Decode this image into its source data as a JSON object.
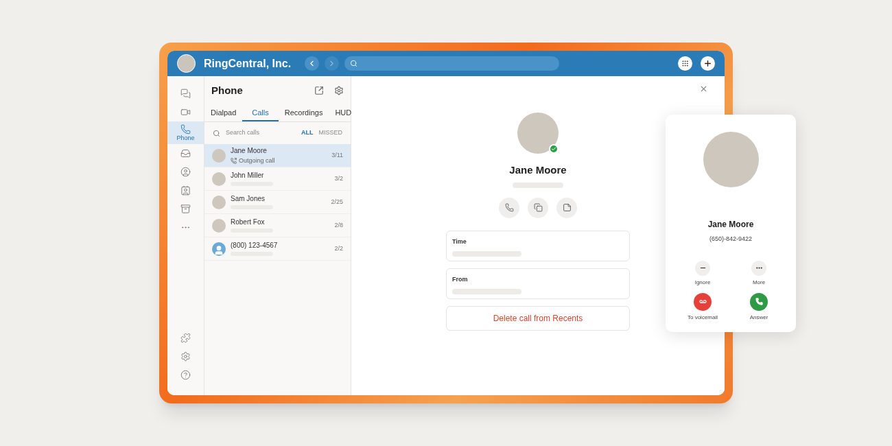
{
  "header": {
    "title": "RingCentral, Inc."
  },
  "rail": {
    "items": [
      {
        "kind": "messages",
        "selected": false
      },
      {
        "kind": "video",
        "selected": false
      },
      {
        "kind": "phone",
        "label": "Phone",
        "selected": true
      },
      {
        "kind": "inbox",
        "selected": false
      },
      {
        "kind": "contacts",
        "selected": false
      },
      {
        "kind": "directory",
        "selected": false
      },
      {
        "kind": "tray",
        "selected": false
      },
      {
        "kind": "more",
        "selected": false
      }
    ],
    "bottom": [
      {
        "kind": "apps"
      },
      {
        "kind": "settings"
      },
      {
        "kind": "help"
      }
    ]
  },
  "panel": {
    "title": "Phone",
    "tabs": [
      {
        "label": "Dialpad",
        "selected": false
      },
      {
        "label": "Calls",
        "selected": true
      },
      {
        "label": "Recordings",
        "selected": false
      },
      {
        "label": "HUD",
        "selected": false
      }
    ],
    "search": {
      "placeholder": "Search calls"
    },
    "filters": [
      {
        "label": "ALL",
        "selected": true
      },
      {
        "label": "MISSED",
        "selected": false
      }
    ],
    "calls": [
      {
        "name": "Jane Moore",
        "detail": "Outgoing call",
        "date": "3/11",
        "selected": true,
        "has_photo": true
      },
      {
        "name": "John Miller",
        "date": "3/2",
        "selected": false,
        "has_photo": true
      },
      {
        "name": "Sam Jones",
        "date": "2/25",
        "selected": false,
        "has_photo": true
      },
      {
        "name": "Robert Fox",
        "date": "2/8",
        "selected": false,
        "has_photo": true
      },
      {
        "name": "(800) 123-4567",
        "date": "2/2",
        "selected": false,
        "has_photo": false
      }
    ]
  },
  "detail": {
    "name": "Jane Moore",
    "online": true,
    "actions": [
      {
        "kind": "call"
      },
      {
        "kind": "message"
      },
      {
        "kind": "note"
      }
    ],
    "fields": [
      {
        "label": "Time"
      },
      {
        "label": "From"
      }
    ],
    "delete_button": "Delete call from Recents"
  },
  "incoming_call": {
    "name": "Jane Moore",
    "number": "(650)-842-9422",
    "actions": [
      {
        "kind": "ignore",
        "label": "Ignore"
      },
      {
        "kind": "more",
        "label": "More"
      },
      {
        "kind": "voicemail",
        "label": "To voicemail"
      },
      {
        "kind": "answer",
        "label": "Answer"
      }
    ]
  }
}
